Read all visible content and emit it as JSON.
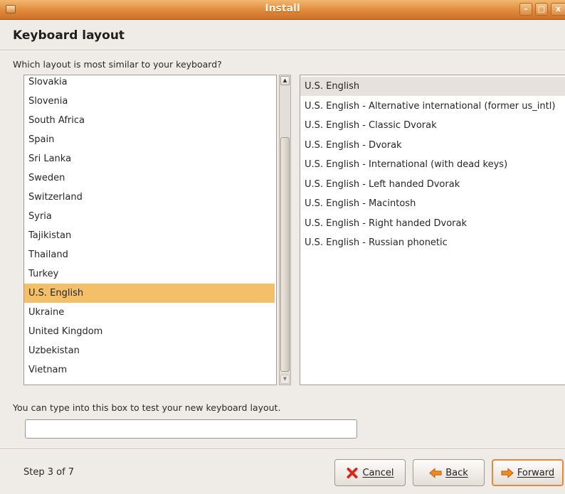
{
  "window": {
    "title": "Install",
    "minimize_glyph": "–",
    "maximize_glyph": "□",
    "close_glyph": "x"
  },
  "page": {
    "heading": "Keyboard layout",
    "question": "Which layout is most similar to your keyboard?",
    "test_label": "You can type into this box to test your new keyboard layout.",
    "test_input_value": "",
    "test_input_placeholder": ""
  },
  "countries": {
    "selected": "U.S. English",
    "items": [
      "Slovakia",
      "Slovenia",
      "South Africa",
      "Spain",
      "Sri Lanka",
      "Sweden",
      "Switzerland",
      "Syria",
      "Tajikistan",
      "Thailand",
      "Turkey",
      "U.S. English",
      "Ukraine",
      "United Kingdom",
      "Uzbekistan",
      "Vietnam"
    ]
  },
  "scrollbar": {
    "up_arrow": "▲",
    "down_arrow": "▼",
    "position_fraction": 0.95
  },
  "variants": {
    "selected": "U.S. English",
    "items": [
      "U.S. English",
      "U.S. English - Alternative international (former us_intl)",
      "U.S. English - Classic Dvorak",
      "U.S. English - Dvorak",
      "U.S. English - International (with dead keys)",
      "U.S. English - Left handed Dvorak",
      "U.S. English - Macintosh",
      "U.S. English - Right handed Dvorak",
      "U.S. English - Russian phonetic"
    ]
  },
  "footer": {
    "step": "Step 3 of 7",
    "cancel_label": "Cancel",
    "back_label": "Back",
    "forward_label": "Forward"
  },
  "icons": {
    "cancel": "red-x-icon",
    "back": "arrow-left-icon",
    "forward": "arrow-right-icon"
  },
  "colors": {
    "titlebar": "#df8a3a",
    "selection": "#f3bf69",
    "button_focus": "#e08a3c",
    "cancel_icon": "#d8281c",
    "arrow_icon": "#f08a1c"
  }
}
